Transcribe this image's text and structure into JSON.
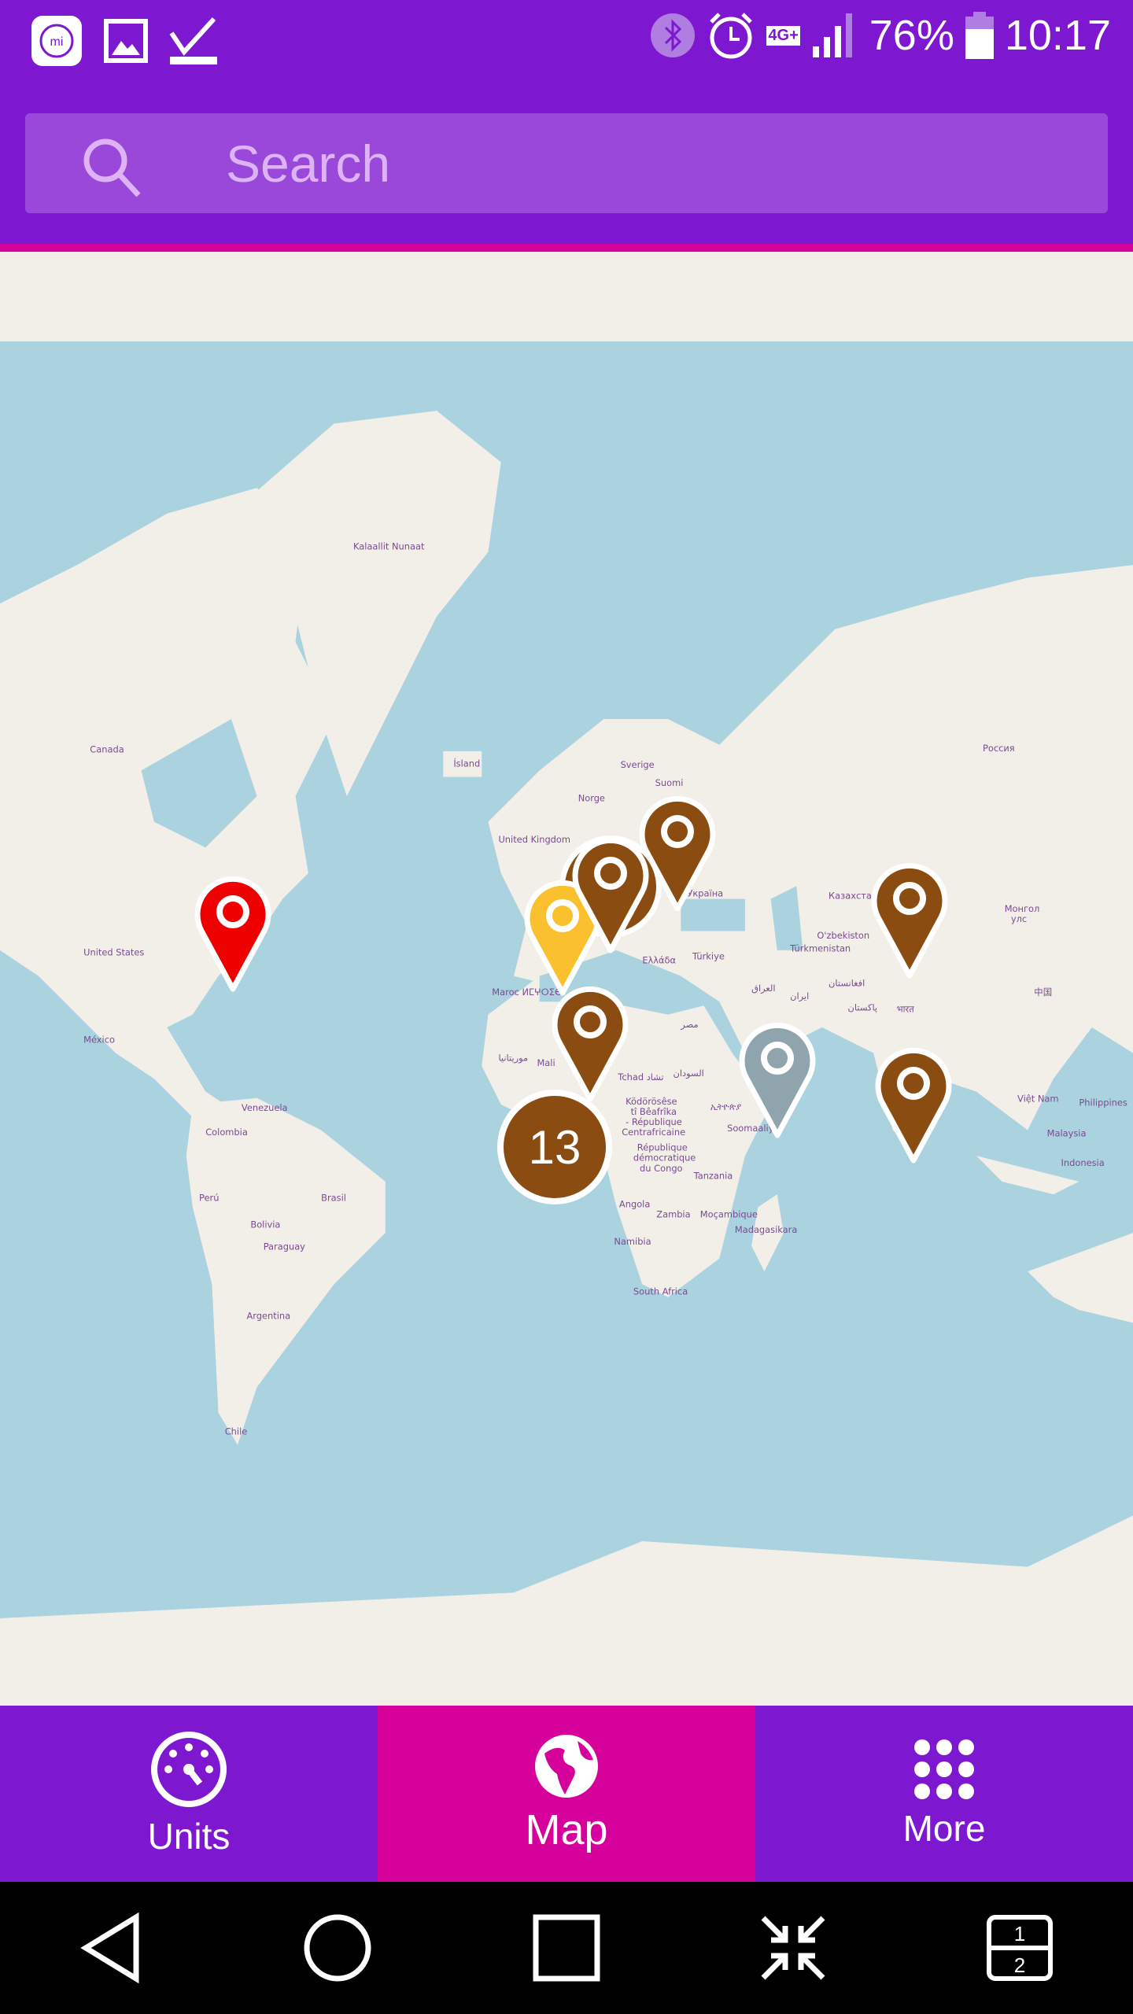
{
  "status_bar": {
    "battery_percent": "76%",
    "time": "10:17",
    "network": "4G+",
    "icons": [
      "mi-home-icon",
      "gallery-icon",
      "download-done-icon",
      "bluetooth-icon",
      "alarm-icon",
      "network-4g-icon",
      "signal-icon",
      "battery-icon"
    ]
  },
  "search": {
    "placeholder": "Search",
    "value": "",
    "icon": "search-icon"
  },
  "map": {
    "labels": {
      "greenland": "Kalaallit Nunaat",
      "canada": "Canada",
      "iceland": "Ísland",
      "sweden": "Sverige",
      "finland": "Suomi",
      "norway": "Norge",
      "uk": "United Kingdom",
      "russia": "Россия",
      "kazakhstan": "Казахстан",
      "mongolia1": "Монгол",
      "mongolia2": "улс",
      "usa": "United States",
      "mexico": "México",
      "ukraine": "Україна",
      "greece": "Ελλάδα",
      "turkey": "Türkiye",
      "uzbekistan": "O'zbekiston",
      "turkmenistan": "Türkmenistan",
      "morocco": "Maroc ⵍⵎⵖⵔⵉⴱ",
      "egypt": "مصر",
      "mauritania": "موريتانيا",
      "mali": "Mali",
      "chad": "Tchad تشاد",
      "sudan": "السودان",
      "car1": "Ködörösêse",
      "car2": "tî Bêafrîka",
      "car3": "- République",
      "car4": "Centrafricaine",
      "drc1": "République",
      "drc2": "démocratique",
      "drc3": "du Congo",
      "tanzania": "Tanzania",
      "angola": "Angola",
      "zambia": "Zambia",
      "mozambique": "Moçambique",
      "namibia": "Namibia",
      "madagascar": "Madagasikara",
      "somalia": "Soomaaliya",
      "south_africa": "South Africa",
      "venezuela": "Venezuela",
      "colombia": "Colombia",
      "peru": "Perú",
      "brazil": "Brasil",
      "bolivia": "Bolivia",
      "paraguay": "Paraguay",
      "argentina": "Argentina",
      "chile": "Chile",
      "china": "中国",
      "india": "भारत",
      "iran": "ایران",
      "iraq": "العراق",
      "afghanistan": "افغانستان",
      "pakistan": "پاکستان",
      "vietnam": "Việt Nam",
      "philippines": "Philippines",
      "malaysia": "Malaysia",
      "indonesia": "Indonesia",
      "ethiopia": "ኢትዮጵያ"
    },
    "markers": [
      {
        "color": "#ee0000",
        "location": "United States east coast"
      },
      {
        "color": "#fbc02d",
        "location": "Western Europe"
      },
      {
        "color": "#8b4c12",
        "location": "Central Europe"
      },
      {
        "color": "#8b4c12",
        "location": "Eastern Europe"
      },
      {
        "color": "#8b4c12",
        "location": "Kazakhstan"
      },
      {
        "color": "#8b4c12",
        "location": "West Africa"
      },
      {
        "color": "#90a4ae",
        "location": "Arabian Sea"
      },
      {
        "color": "#8b4c12",
        "location": "Indian Ocean"
      }
    ],
    "cluster": {
      "count": "13",
      "color": "#8b4c12"
    },
    "colors": {
      "water": "#aad3df",
      "land": "#f2efe9"
    }
  },
  "bottom_nav": {
    "tabs": [
      {
        "label": "Units",
        "icon": "speedometer-icon"
      },
      {
        "label": "Map",
        "icon": "globe-icon",
        "active": true
      },
      {
        "label": "More",
        "icon": "grid-dots-icon"
      }
    ]
  },
  "system_nav": {
    "icons": [
      "back-icon",
      "home-icon",
      "recents-icon",
      "collapse-icon",
      "dual-window-icon"
    ],
    "dual_window": [
      "1",
      "2"
    ]
  },
  "colors": {
    "header": "#7e18d0",
    "accent": "#d6009a",
    "search_bg": "#9a48d9"
  }
}
